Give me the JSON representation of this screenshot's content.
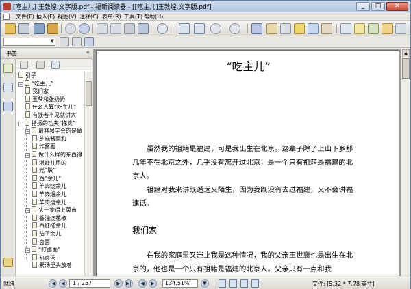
{
  "window": {
    "title": "[吃主儿] 王敦煌.文字版.pdf - 福昕阅读器 - [[吃主儿]王敦煌.文字版.pdf]",
    "min": "_",
    "max": "□",
    "close": "✕"
  },
  "menu": [
    "文件(F)",
    "插入(E)",
    "视图(V)",
    "注释(C)",
    "表单(R)",
    "工具(T)",
    "帮助(H)"
  ],
  "bookmarks": {
    "title": "书签",
    "collapse": "«",
    "items": [
      {
        "label": "引子",
        "depth": 0,
        "toggle": ""
      },
      {
        "label": "“吃主儿”",
        "depth": 0,
        "toggle": "−"
      },
      {
        "label": "我们家",
        "depth": 1,
        "toggle": ""
      },
      {
        "label": "玉爷和张奶奶",
        "depth": 1,
        "toggle": ""
      },
      {
        "label": "什么人算“吃主儿”",
        "depth": 1,
        "toggle": ""
      },
      {
        "label": "有钱者不见就讲大",
        "depth": 1,
        "toggle": ""
      },
      {
        "label": "拾掇的功夫“拣卖”",
        "depth": 0,
        "toggle": "−"
      },
      {
        "label": "最容易学会的是做",
        "depth": 1,
        "toggle": "−"
      },
      {
        "label": "芝麻酱面和",
        "depth": 2,
        "toggle": ""
      },
      {
        "label": "炸酱面",
        "depth": 2,
        "toggle": ""
      },
      {
        "label": "做什么样的东西得",
        "depth": 1,
        "toggle": "−"
      },
      {
        "label": "堪炒儿用的",
        "depth": 2,
        "toggle": ""
      },
      {
        "label": "光“墩”",
        "depth": 2,
        "toggle": ""
      },
      {
        "label": "西“余儿”",
        "depth": 2,
        "toggle": ""
      },
      {
        "label": "羊肉烧余儿",
        "depth": 2,
        "toggle": ""
      },
      {
        "label": "羊肉熘余儿",
        "depth": 2,
        "toggle": ""
      },
      {
        "label": "羊肉烧余儿",
        "depth": 2,
        "toggle": ""
      },
      {
        "label": "头一步得上菜市",
        "depth": 1,
        "toggle": "−"
      },
      {
        "label": "香油烧花椒",
        "depth": 2,
        "toggle": ""
      },
      {
        "label": "西红柿余儿",
        "depth": 2,
        "toggle": ""
      },
      {
        "label": "茄子余儿",
        "depth": 2,
        "toggle": ""
      },
      {
        "label": "卤面",
        "depth": 2,
        "toggle": ""
      },
      {
        "label": "“打卤面”",
        "depth": 1,
        "toggle": "−"
      },
      {
        "label": "热卤汤",
        "depth": 2,
        "toggle": ""
      },
      {
        "label": "素汤里头放着",
        "depth": 2,
        "toggle": ""
      }
    ]
  },
  "document": {
    "title": "“吃主儿”",
    "para1": "虽然我的祖籍是福建，可是我出生在北京。这辈子除了上山下乡那几年不在北京之外，几乎没有离开过北京，是一个只有祖籍是福建的北京人。",
    "para2": "祖籍对我来讲既遥远又陌生，因为我既没有去过福建，又不会讲福建话。",
    "section": "我们家",
    "para3": "在我的家庭里又岂止我是这种情况，我的父亲王世襄也是出生在北京的，他也是一个只有祖籍是福建的北京人。父亲只有一点和我"
  },
  "status": {
    "ready": "就绪",
    "page": "1 / 257",
    "zoom": "134.51%",
    "file_info": "文件: [5.32 * 7.78 英寸]"
  },
  "colors": {
    "accent": "#5a7ca8",
    "page_bg": "#ffffff",
    "workspace": "#9c9c9c"
  }
}
